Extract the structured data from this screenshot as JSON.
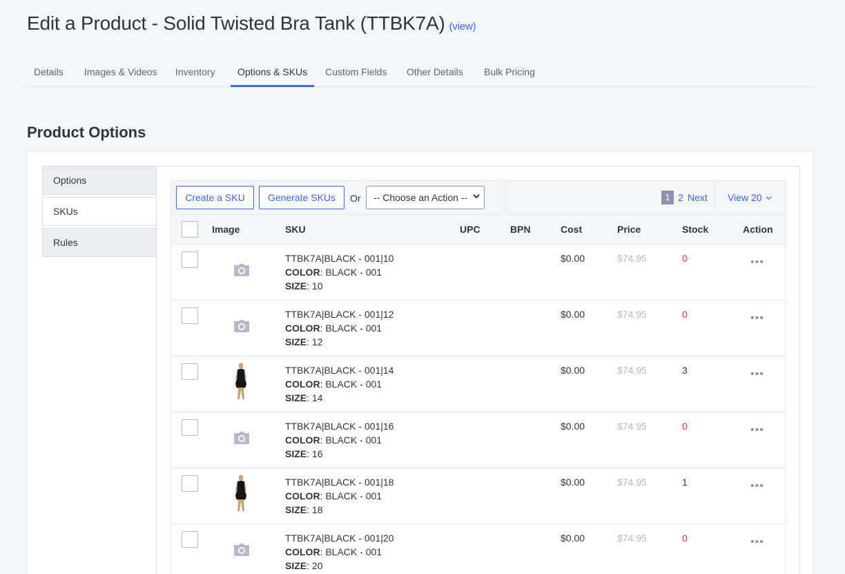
{
  "header": {
    "title": "Edit a Product - Solid Twisted Bra Tank (TTBK7A)",
    "view_link": "(view)"
  },
  "tabs": [
    {
      "label": "Details"
    },
    {
      "label": "Images & Videos"
    },
    {
      "label": "Inventory"
    },
    {
      "label": "Options & SKUs",
      "active": true
    },
    {
      "label": "Custom Fields"
    },
    {
      "label": "Other Details"
    },
    {
      "label": "Bulk Pricing"
    }
  ],
  "section_title": "Product Options",
  "side_tabs": [
    {
      "label": "Options"
    },
    {
      "label": "SKUs",
      "active": true
    },
    {
      "label": "Rules"
    }
  ],
  "toolbar": {
    "create_sku": "Create a SKU",
    "generate_skus": "Generate SKUs",
    "or": "Or",
    "action_select": "-- Choose an Action --",
    "page_current": "1",
    "page_2": "2",
    "next": "Next",
    "view_per": "View 20"
  },
  "table": {
    "headers": {
      "image": "Image",
      "sku": "SKU",
      "upc": "UPC",
      "bpn": "BPN",
      "cost": "Cost",
      "price": "Price",
      "stock": "Stock",
      "action": "Action"
    },
    "color_label": "COLOR",
    "size_label": "SIZE",
    "rows": [
      {
        "sku": "TTBK7A|BLACK - 001|10",
        "color": ": BLACK - 001",
        "size": ": 10",
        "cost": "$0.00",
        "price": "$74.95",
        "stock": "0",
        "image": "camera-icon"
      },
      {
        "sku": "TTBK7A|BLACK - 001|12",
        "color": ": BLACK - 001",
        "size": ": 12",
        "cost": "$0.00",
        "price": "$74.95",
        "stock": "0",
        "image": "camera-icon"
      },
      {
        "sku": "TTBK7A|BLACK - 001|14",
        "color": ": BLACK - 001",
        "size": ": 14",
        "cost": "$0.00",
        "price": "$74.95",
        "stock": "3",
        "image": "product-thumbnail"
      },
      {
        "sku": "TTBK7A|BLACK - 001|16",
        "color": ": BLACK - 001",
        "size": ": 16",
        "cost": "$0.00",
        "price": "$74.95",
        "stock": "0",
        "image": "camera-icon"
      },
      {
        "sku": "TTBK7A|BLACK - 001|18",
        "color": ": BLACK - 001",
        "size": ": 18",
        "cost": "$0.00",
        "price": "$74.95",
        "stock": "1",
        "image": "product-thumbnail"
      },
      {
        "sku": "TTBK7A|BLACK - 001|20",
        "color": ": BLACK - 001",
        "size": ": 20",
        "cost": "$0.00",
        "price": "$74.95",
        "stock": "0",
        "image": "camera-icon"
      }
    ]
  },
  "colors": {
    "accent": "#3c64f4",
    "stock_zero": "#db3643",
    "muted_price": "#b5bac9"
  }
}
